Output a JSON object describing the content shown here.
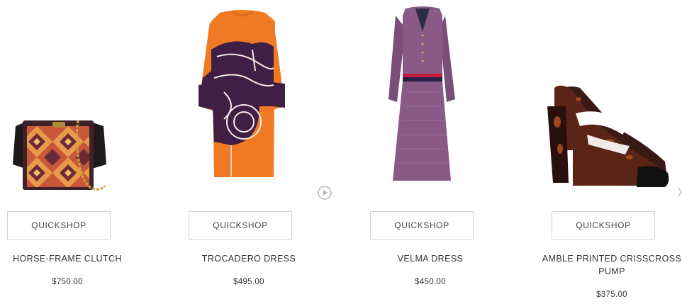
{
  "products": [
    {
      "name": "HORSE-FRAME CLUTCH",
      "price": "$750.00",
      "quickshop": "QUICKSHOP"
    },
    {
      "name": "TROCADERO DRESS",
      "price": "$495.00",
      "quickshop": "QUICKSHOP"
    },
    {
      "name": "VELMA DRESS",
      "price": "$450.00",
      "quickshop": "QUICKSHOP"
    },
    {
      "name": "AMBLE PRINTED CRISSCROSS PUMP",
      "price": "$375.00",
      "quickshop": "QUICKSHOP"
    }
  ],
  "icons": {
    "play": "play-circle-icon"
  }
}
